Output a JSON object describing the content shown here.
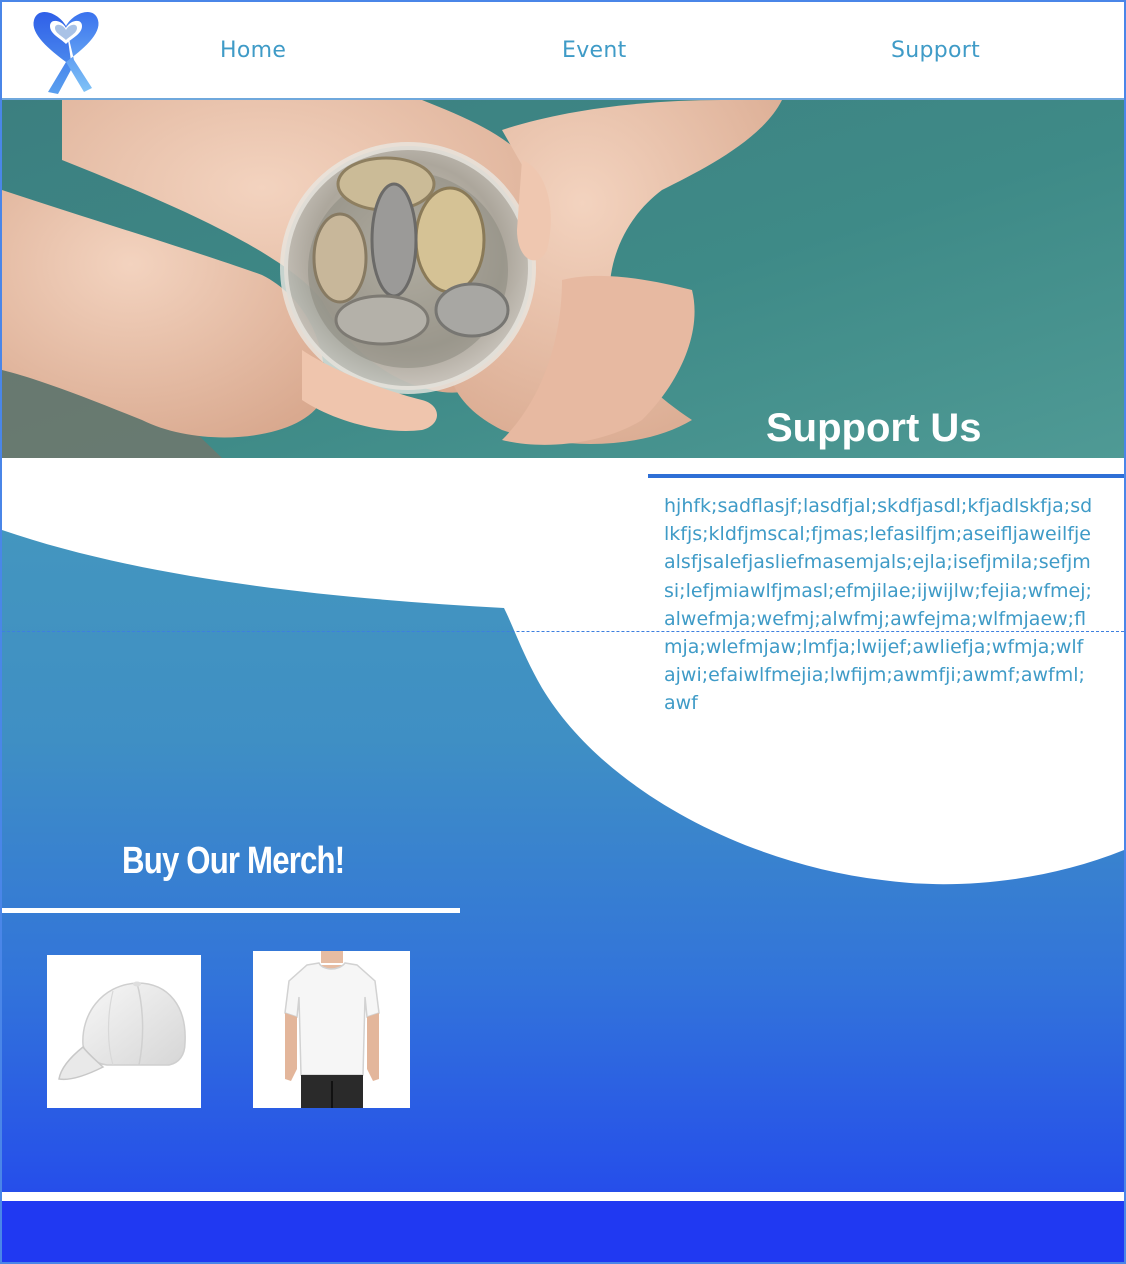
{
  "nav": {
    "items": [
      {
        "label": "Home"
      },
      {
        "label": "Event"
      },
      {
        "label": "Support"
      }
    ]
  },
  "hero": {
    "title": "Support Us"
  },
  "support": {
    "body": "hjhfk;sadflasjf;lasdfjal;skdfjasdl;kfjadlskfja;sdlkfjs;kldfjmscal;fjmas;lefasilfjm;aseifljaweilfjealsfjsalefjasliefmasemjals;ejla;isefjmila;sefjmsi;lefjmiawlfjmasl;efmjilae;ijwijlw;fejia;wfmej;alwefmja;wefmj;alwfmj;awfejma;wlfmjaew;flmja;wlefmjaw;lmfja;lwijef;awliefja;wfmja;wlfajwi;efaiwlfmejia;lwfijm;awmfji;awmf;awfml;awf"
  },
  "merch": {
    "title": "Buy Our Merch!",
    "products": [
      {
        "icon": "cap-icon"
      },
      {
        "icon": "tshirt-icon"
      }
    ]
  },
  "colors": {
    "nav_text": "#3f9bc7",
    "gradient_top": "#4598bd",
    "gradient_bottom": "#2141f0",
    "footer": "#2039f2",
    "accent_rule": "#2e6fd6"
  }
}
